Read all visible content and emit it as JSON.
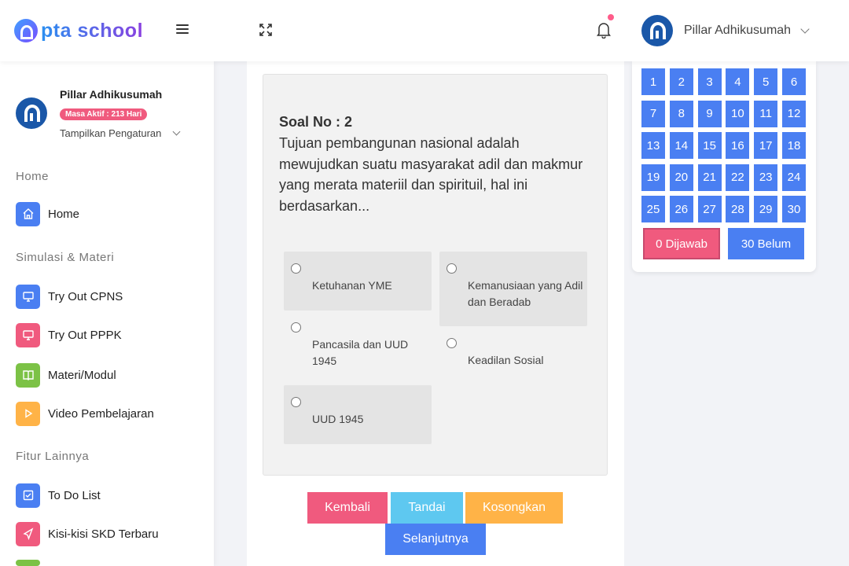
{
  "brand": {
    "logo_text": "pta school"
  },
  "header": {
    "user_name": "Pillar Adhikusumah"
  },
  "sidebar": {
    "user_name": "Pillar Adhikusumah",
    "badge": "Masa Aktif : 213 Hari",
    "settings_label": "Tampilkan Pengaturan",
    "sections": [
      {
        "label": "Home"
      },
      {
        "label": "Simulasi & Materi"
      },
      {
        "label": "Fitur Lainnya"
      }
    ],
    "items": [
      {
        "label": "Home",
        "icon": "home-icon",
        "color": "#4a7ff2"
      },
      {
        "label": "Try Out CPNS",
        "icon": "monitor-icon",
        "color": "#4a7ff2"
      },
      {
        "label": "Try Out PPPK",
        "icon": "monitor-icon",
        "color": "#f05a7e"
      },
      {
        "label": "Materi/Modul",
        "icon": "book-icon",
        "color": "#7cc246"
      },
      {
        "label": "Video Pembelajaran",
        "icon": "play-icon",
        "color": "#ffb347"
      },
      {
        "label": "To Do List",
        "icon": "checkbox-icon",
        "color": "#4a7ff2"
      },
      {
        "label": "Kisi-kisi SKD Terbaru",
        "icon": "send-icon",
        "color": "#f05a7e"
      }
    ]
  },
  "question": {
    "number_label": "Soal No : 2",
    "text": "Tujuan pembangunan nasional adalah mewujudkan suatu masyarakat adil dan makmur yang merata materiil dan spirituil, hal ini berdasarkan...",
    "options": [
      {
        "text": "Ketuhanan YME"
      },
      {
        "text": "Kemanusiaan yang Adil dan Beradab"
      },
      {
        "text": "Pancasila dan UUD 1945"
      },
      {
        "text": "Keadilan Sosial"
      },
      {
        "text": "UUD 1945"
      }
    ]
  },
  "actions": {
    "back": "Kembali",
    "mark": "Tandai",
    "clear": "Kosongkan",
    "next": "Selanjutnya"
  },
  "navigator": {
    "numbers": [
      "1",
      "2",
      "3",
      "4",
      "5",
      "6",
      "7",
      "8",
      "9",
      "10",
      "11",
      "12",
      "13",
      "14",
      "15",
      "16",
      "17",
      "18",
      "19",
      "20",
      "21",
      "22",
      "23",
      "24",
      "25",
      "26",
      "27",
      "28",
      "29",
      "30"
    ],
    "answered": "0 Dijawab",
    "unanswered": "30 Belum"
  },
  "colors": {
    "primary": "#4a7ff2",
    "danger": "#f05a7e",
    "info": "#5ec8f0",
    "warning": "#ffb347",
    "success": "#7cc246"
  }
}
